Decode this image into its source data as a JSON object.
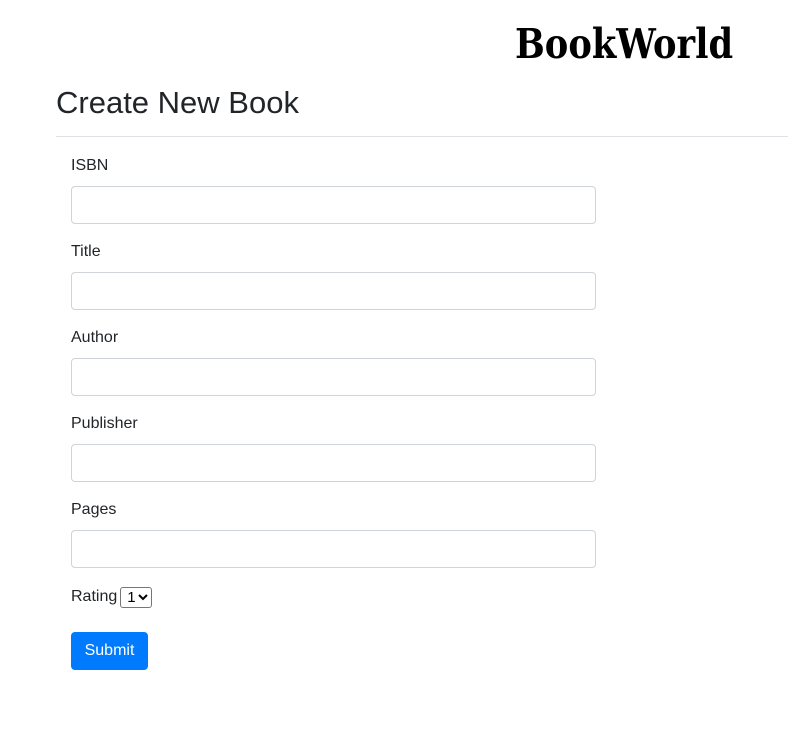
{
  "header": {
    "brand": "BookWorld"
  },
  "page": {
    "title": "Create New Book"
  },
  "form": {
    "fields": [
      {
        "label": "ISBN",
        "value": ""
      },
      {
        "label": "Title",
        "value": ""
      },
      {
        "label": "Author",
        "value": ""
      },
      {
        "label": "Publisher",
        "value": ""
      },
      {
        "label": "Pages",
        "value": ""
      }
    ],
    "rating": {
      "label": "Rating",
      "selected": "1"
    },
    "submit_label": "Submit"
  },
  "colors": {
    "primary": "#007bff",
    "text": "#212529",
    "input_border": "#ced4da",
    "divider": "#dee2e6"
  }
}
